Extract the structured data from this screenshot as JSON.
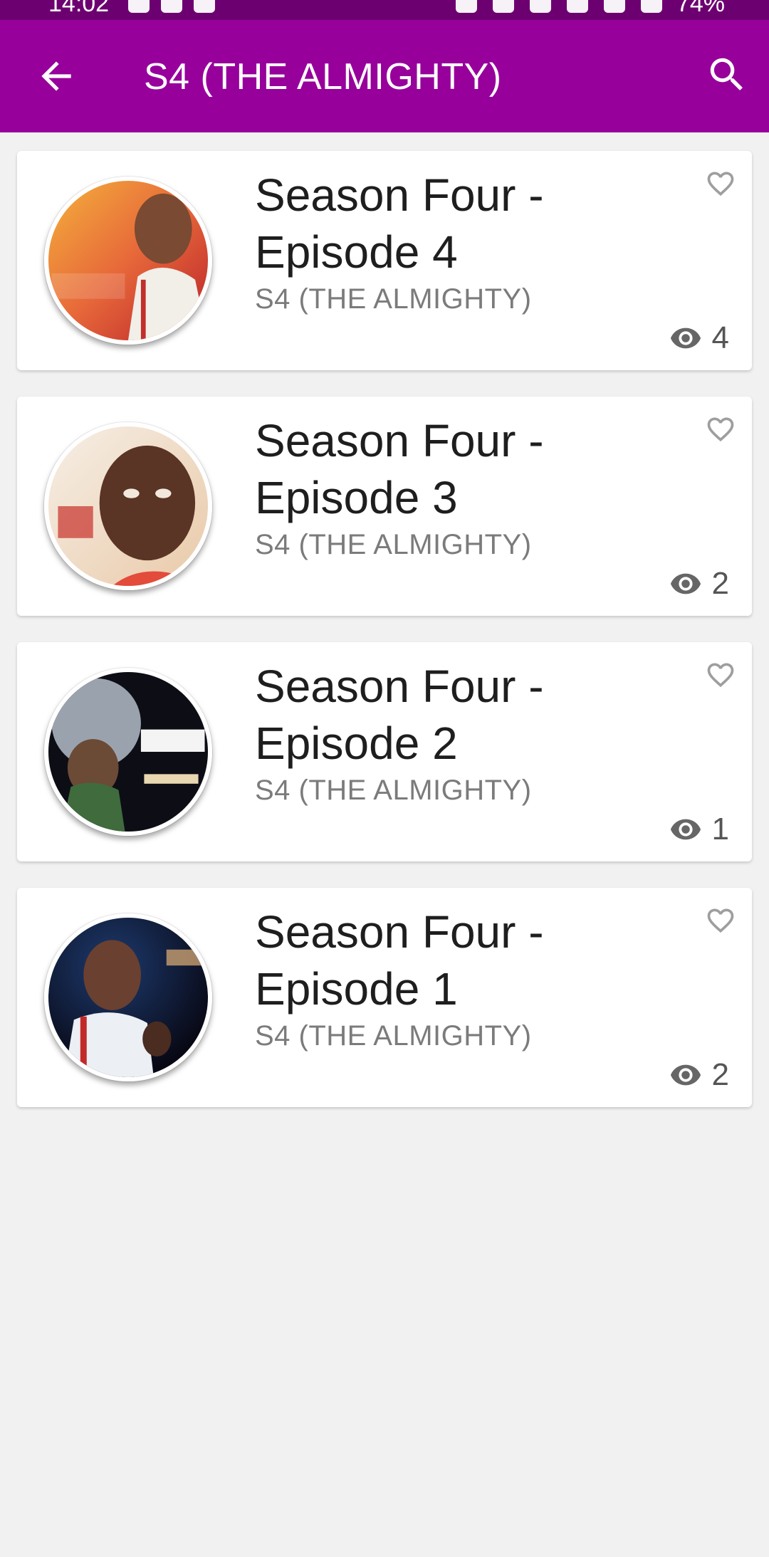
{
  "status_bar": {
    "time": "14:02",
    "battery": "74%"
  },
  "app_bar": {
    "title": "S4 (THE ALMIGHTY)",
    "back_icon": "arrow-back-icon",
    "search_icon": "search-icon"
  },
  "colors": {
    "status_bar": "#6d0070",
    "app_bar": "#97009b",
    "background": "#f1f1f1"
  },
  "episodes": [
    {
      "title": "Season Four - Episode 4",
      "subtitle": "S4 (THE ALMIGHTY)",
      "views": "4"
    },
    {
      "title": "Season Four - Episode 3",
      "subtitle": "S4 (THE ALMIGHTY)",
      "views": "2"
    },
    {
      "title": "Season Four - Episode 2",
      "subtitle": "S4 (THE ALMIGHTY)",
      "views": "1"
    },
    {
      "title": "Season Four - Episode 1",
      "subtitle": "S4 (THE ALMIGHTY)",
      "views": "2"
    }
  ]
}
